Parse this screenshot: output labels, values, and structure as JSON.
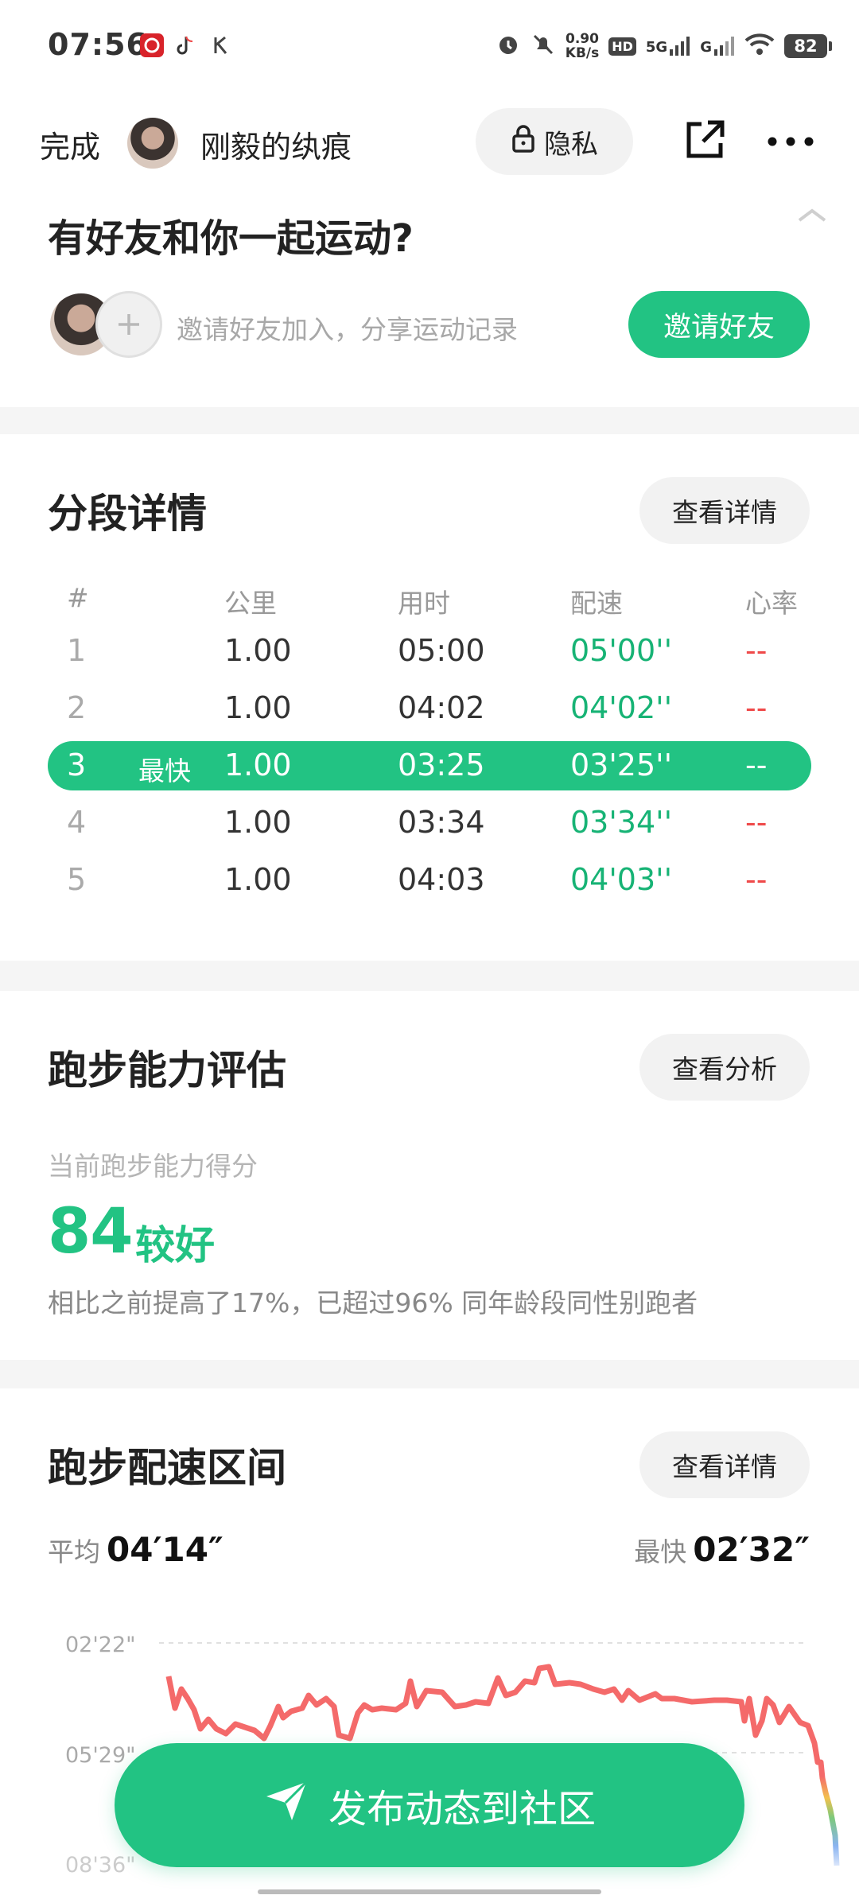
{
  "status_bar": {
    "time": "07:56",
    "speed_value": "0.90",
    "speed_unit": "KB/s",
    "hd_label": "HD",
    "network_5g": "5G",
    "network_g": "G",
    "battery": "82",
    "icons": [
      "netease-music-icon",
      "tiktok-icon",
      "k-app-icon",
      "alarm-icon",
      "mute-icon",
      "wifi-icon"
    ]
  },
  "nav": {
    "done_label": "完成",
    "nickname": "刚毅的纨痕",
    "privacy_label": "隐私"
  },
  "invite": {
    "title": "有好友和你一起运动?",
    "text": "邀请好友加入，分享运动记录",
    "button": "邀请好友"
  },
  "splits": {
    "title": "分段详情",
    "button": "查看详情",
    "headers": [
      "#",
      "公里",
      "用时",
      "配速",
      "心率"
    ],
    "rows": [
      {
        "idx": "1",
        "km": "1.00",
        "time": "05:00",
        "pace": "05'00''",
        "hr": "--"
      },
      {
        "idx": "2",
        "km": "1.00",
        "time": "04:02",
        "pace": "04'02''",
        "hr": "--"
      },
      {
        "idx": "3",
        "tag": "最快",
        "km": "1.00",
        "time": "03:25",
        "pace": "03'25''",
        "hr": "--"
      },
      {
        "idx": "4",
        "km": "1.00",
        "time": "03:34",
        "pace": "03'34''",
        "hr": "--"
      },
      {
        "idx": "5",
        "km": "1.00",
        "time": "04:03",
        "pace": "04'03''",
        "hr": "--"
      }
    ]
  },
  "ability": {
    "title": "跑步能力评估",
    "button": "查看分析",
    "label": "当前跑步能力得分",
    "score": "84",
    "level": "较好",
    "desc": "相比之前提高了17%，已超过96% 同年龄段同性别跑者"
  },
  "pace_zone": {
    "title": "跑步配速区间",
    "button": "查看详情",
    "avg_label": "平均",
    "avg_value": "04′14″",
    "fast_label": "最快",
    "fast_value": "02′32″"
  },
  "chart_data": {
    "type": "line",
    "y_tick_labels": [
      "02'22\"",
      "05'29\"",
      "08'36\""
    ],
    "y_axis_inverted": true,
    "grid": true,
    "color_scale": [
      "#f46a6a",
      "#f2c14e",
      "#7cc97c",
      "#8ab4f0"
    ]
  },
  "fab": {
    "label": "发布动态到社区"
  },
  "colors": {
    "accent": "#22c383",
    "pace_green": "#17b375",
    "heart_red": "#ef4a4a",
    "chart_red": "#f46a6a"
  }
}
